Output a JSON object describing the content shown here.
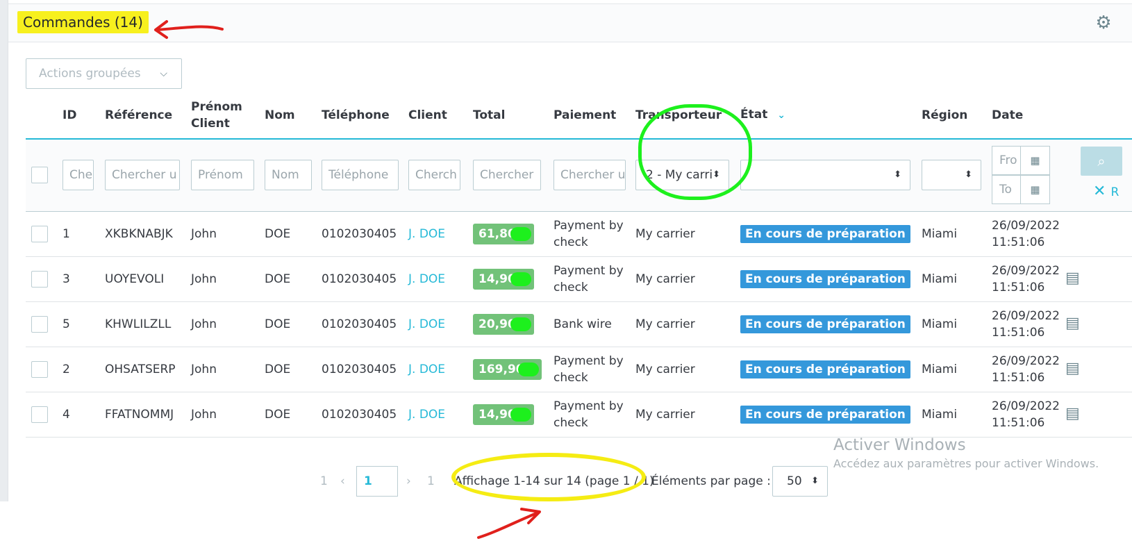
{
  "header": {
    "title": "Commandes (14)",
    "settings_icon": "gear-icon"
  },
  "bulk_actions": {
    "label": "Actions groupées",
    "icon": "chevron-down-icon"
  },
  "columns": {
    "id": "ID",
    "reference": "Référence",
    "firstname_line1": "Prénom",
    "firstname_line2": "Client",
    "lastname": "Nom",
    "phone": "Téléphone",
    "customer": "Client",
    "total": "Total",
    "payment": "Paiement",
    "carrier": "Transporteur",
    "state": "État",
    "region": "Région",
    "date": "Date"
  },
  "filters": {
    "id_placeholder": "Che",
    "reference_placeholder": "Chercher u",
    "firstname_placeholder": "Prénom",
    "lastname_placeholder": "Nom",
    "phone_placeholder": "Téléphone",
    "customer_placeholder": "Cherch",
    "total_placeholder": "Chercher",
    "payment_placeholder": "Chercher u",
    "carrier_selected": "2 - My carri",
    "state_selected": "",
    "region_selected": "",
    "date_from_placeholder": "Fro",
    "date_to_placeholder": "To",
    "search_icon": "search-icon",
    "reset_label": "R",
    "reset_icon": "close-icon"
  },
  "orders": [
    {
      "id": "1",
      "reference": "XKBKNABJK",
      "firstname": "John",
      "lastname": "DOE",
      "phone": "0102030405",
      "customer": "J. DOE",
      "total": "61,80",
      "payment_line1": "Payment by",
      "payment_line2": "check",
      "carrier": "My carrier",
      "state": "En cours de préparation",
      "region": "Miami",
      "date_line1": "26/09/2022",
      "date_line2": "11:51:06",
      "has_doc": false
    },
    {
      "id": "3",
      "reference": "UOYEVOLI",
      "firstname": "John",
      "lastname": "DOE",
      "phone": "0102030405",
      "customer": "J. DOE",
      "total": "14,90",
      "payment_line1": "Payment by",
      "payment_line2": "check",
      "carrier": "My carrier",
      "state": "En cours de préparation",
      "region": "Miami",
      "date_line1": "26/09/2022",
      "date_line2": "11:51:06",
      "has_doc": true
    },
    {
      "id": "5",
      "reference": "KHWLILZLL",
      "firstname": "John",
      "lastname": "DOE",
      "phone": "0102030405",
      "customer": "J. DOE",
      "total": "20,90",
      "payment_line1": "Bank wire",
      "payment_line2": "",
      "carrier": "My carrier",
      "state": "En cours de préparation",
      "region": "Miami",
      "date_line1": "26/09/2022",
      "date_line2": "11:51:06",
      "has_doc": true
    },
    {
      "id": "2",
      "reference": "OHSATSERP",
      "firstname": "John",
      "lastname": "DOE",
      "phone": "0102030405",
      "customer": "J. DOE",
      "total": "169,90",
      "payment_line1": "Payment by",
      "payment_line2": "check",
      "carrier": "My carrier",
      "state": "En cours de préparation",
      "region": "Miami",
      "date_line1": "26/09/2022",
      "date_line2": "11:51:06",
      "has_doc": true
    },
    {
      "id": "4",
      "reference": "FFATNOMMJ",
      "firstname": "John",
      "lastname": "DOE",
      "phone": "0102030405",
      "customer": "J. DOE",
      "total": "14,90",
      "payment_line1": "Payment by",
      "payment_line2": "check",
      "carrier": "My carrier",
      "state": "En cours de préparation",
      "region": "Miami",
      "date_line1": "26/09/2022",
      "date_line2": "11:51:06",
      "has_doc": true
    }
  ],
  "pagination": {
    "first_page": "1",
    "current_page": "1",
    "last_page": "1",
    "info": "Affichage 1-14 sur 14 (page 1 / 1)",
    "per_page_label": "Éléments par page :",
    "per_page_value": "50"
  },
  "watermark": {
    "line1": "Activer Windows",
    "line2": "Accédez aux paramètres pour activer Windows."
  },
  "colors": {
    "accent": "#25b9d7",
    "total_badge": "#72c279",
    "state_badge": "#3498db",
    "highlight_yellow": "#f7f01e",
    "annotation_green": "#1df01d",
    "annotation_red": "#e0201c"
  }
}
